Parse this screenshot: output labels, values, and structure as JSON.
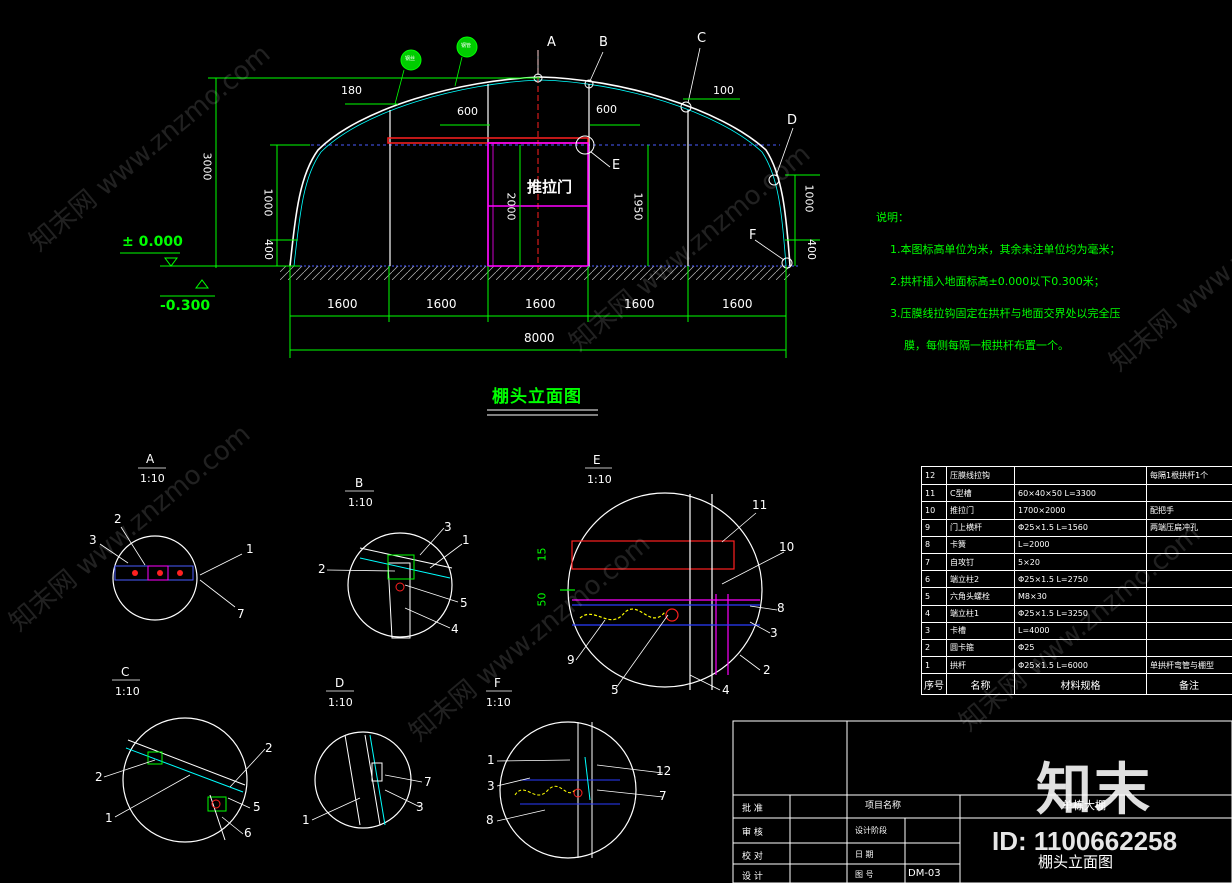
{
  "elevation": {
    "title": "棚头立面图",
    "axis_labels": [
      "A",
      "B",
      "C",
      "D",
      "E",
      "F"
    ],
    "door_label": "推拉门",
    "dims": {
      "d180": "180",
      "d600a": "600",
      "d600b": "600",
      "d100": "100",
      "d3000": "3000",
      "d1000l": "1000",
      "d400l": "400",
      "d2000": "2000",
      "d1950": "1950",
      "d1000r": "1000",
      "d400r": "400",
      "spans": [
        "1600",
        "1600",
        "1600",
        "1600",
        "1600"
      ],
      "total": "8000"
    },
    "levels": {
      "zero": "± 0.000",
      "minus": "-0.300"
    },
    "circle_tags": [
      "钢丝",
      "钢管"
    ]
  },
  "notes": {
    "header": "说明：",
    "lines": [
      "1.本图标高单位为米，其余未注单位均为毫米；",
      "2.拱杆插入地面标高±0.000以下0.300米；",
      "3.压膜线拉钩固定在拱杆与地面交界处以完全压",
      "膜，每侧每隔一根拱杆布置一个。"
    ]
  },
  "details": [
    {
      "id": "A",
      "scale": "1:10",
      "callouts": [
        "2",
        "3",
        "1",
        "7"
      ]
    },
    {
      "id": "B",
      "scale": "1:10",
      "callouts": [
        "3",
        "1",
        "2",
        "5",
        "4"
      ]
    },
    {
      "id": "E",
      "scale": "1:10",
      "callouts": [
        "11",
        "10",
        "15",
        "50",
        "8",
        "3",
        "9",
        "5",
        "4",
        "2"
      ]
    },
    {
      "id": "C",
      "scale": "1:10",
      "callouts": [
        "2",
        "2",
        "1",
        "5",
        "6"
      ]
    },
    {
      "id": "D",
      "scale": "1:10",
      "callouts": [
        "7",
        "1",
        "3"
      ]
    },
    {
      "id": "F",
      "scale": "1:10",
      "callouts": [
        "1",
        "12",
        "3",
        "7",
        "8"
      ]
    }
  ],
  "materials": {
    "rows": [
      {
        "no": "12",
        "name": "压膜线拉钩",
        "spec": "",
        "note": "每隔1根拱杆1个"
      },
      {
        "no": "11",
        "name": "C型槽",
        "spec": "60×40×50  L=3300",
        "note": ""
      },
      {
        "no": "10",
        "name": "推拉门",
        "spec": "1700×2000",
        "note": "配把手"
      },
      {
        "no": "9",
        "name": "门上横杆",
        "spec": "Φ25×1.5   L=1560",
        "note": "两端压扁冲孔"
      },
      {
        "no": "8",
        "name": "卡簧",
        "spec": "L=2000",
        "note": ""
      },
      {
        "no": "7",
        "name": "自攻钉",
        "spec": "5×20",
        "note": ""
      },
      {
        "no": "6",
        "name": "端立柱2",
        "spec": "Φ25×1.5   L=2750",
        "note": ""
      },
      {
        "no": "5",
        "name": "六角头螺栓",
        "spec": "M8×30",
        "note": ""
      },
      {
        "no": "4",
        "name": "端立柱1",
        "spec": "Φ25×1.5   L=3250",
        "note": ""
      },
      {
        "no": "3",
        "name": "卡槽",
        "spec": "L=4000",
        "note": ""
      },
      {
        "no": "2",
        "name": "圆卡箍",
        "spec": "Φ25",
        "note": ""
      },
      {
        "no": "1",
        "name": "拱杆",
        "spec": "Φ25×1.5  L=6000",
        "note": "单拱杆弯管与棚型"
      }
    ],
    "header": {
      "no": "序号",
      "name": "名称",
      "spec": "材料规格",
      "note": "备注"
    }
  },
  "title_block": {
    "left_labels": [
      "批 准",
      "审 核",
      "校 对",
      "设 计"
    ],
    "mid_labels": [
      "项目名称",
      "设计阶段",
      "日 期",
      "图 号"
    ],
    "drawing_no": "DM-03",
    "project": "单栋大棚",
    "drawing_name": "棚头立面图"
  },
  "watermark": {
    "brand": "知末",
    "id_text": "ID: 1100662258",
    "diag": [
      "知末网 www.znzmo.com"
    ]
  },
  "colors": {
    "white": "#ffffff",
    "green": "#00ff00",
    "cyan": "#00ffff",
    "red": "#ff2020",
    "magenta": "#ff00ff",
    "blue": "#2a3cff",
    "yellow": "#ffff00"
  }
}
